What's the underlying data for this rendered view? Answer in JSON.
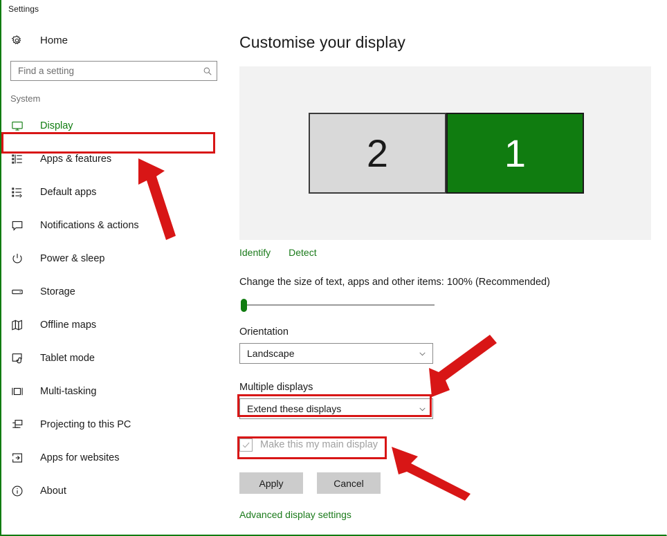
{
  "window": {
    "title": "Settings",
    "accent_color": "#107c10",
    "annotation_color": "#d81616"
  },
  "sidebar": {
    "home": {
      "label": "Home",
      "icon": "gear-icon"
    },
    "search": {
      "placeholder": "Find a setting",
      "value": "",
      "icon": "search-icon"
    },
    "section_label": "System",
    "items": [
      {
        "label": "Display",
        "icon": "monitor-icon",
        "selected": true
      },
      {
        "label": "Apps & features",
        "icon": "list-icon",
        "selected": false
      },
      {
        "label": "Default apps",
        "icon": "default-apps-icon",
        "selected": false
      },
      {
        "label": "Notifications & actions",
        "icon": "notification-icon",
        "selected": false
      },
      {
        "label": "Power & sleep",
        "icon": "power-icon",
        "selected": false
      },
      {
        "label": "Storage",
        "icon": "storage-icon",
        "selected": false
      },
      {
        "label": "Offline maps",
        "icon": "map-icon",
        "selected": false
      },
      {
        "label": "Tablet mode",
        "icon": "tablet-icon",
        "selected": false
      },
      {
        "label": "Multi-tasking",
        "icon": "multitask-icon",
        "selected": false
      },
      {
        "label": "Projecting to this PC",
        "icon": "project-icon",
        "selected": false
      },
      {
        "label": "Apps for websites",
        "icon": "apps-websites-icon",
        "selected": false
      },
      {
        "label": "About",
        "icon": "info-icon",
        "selected": false
      }
    ]
  },
  "main": {
    "title": "Customise your display",
    "monitors": [
      {
        "number": "2",
        "active": false
      },
      {
        "number": "1",
        "active": true
      }
    ],
    "identify_link": "Identify",
    "detect_link": "Detect",
    "scale_label": "Change the size of text, apps and other items: 100% (Recommended)",
    "scale_value": "100%",
    "orientation_label": "Orientation",
    "orientation_value": "Landscape",
    "multiple_displays_label": "Multiple displays",
    "multiple_displays_value": "Extend these displays",
    "main_display_checkbox": {
      "label": "Make this my main display",
      "checked": true,
      "disabled": true
    },
    "apply_button": "Apply",
    "cancel_button": "Cancel",
    "advanced_link": "Advanced display settings"
  }
}
